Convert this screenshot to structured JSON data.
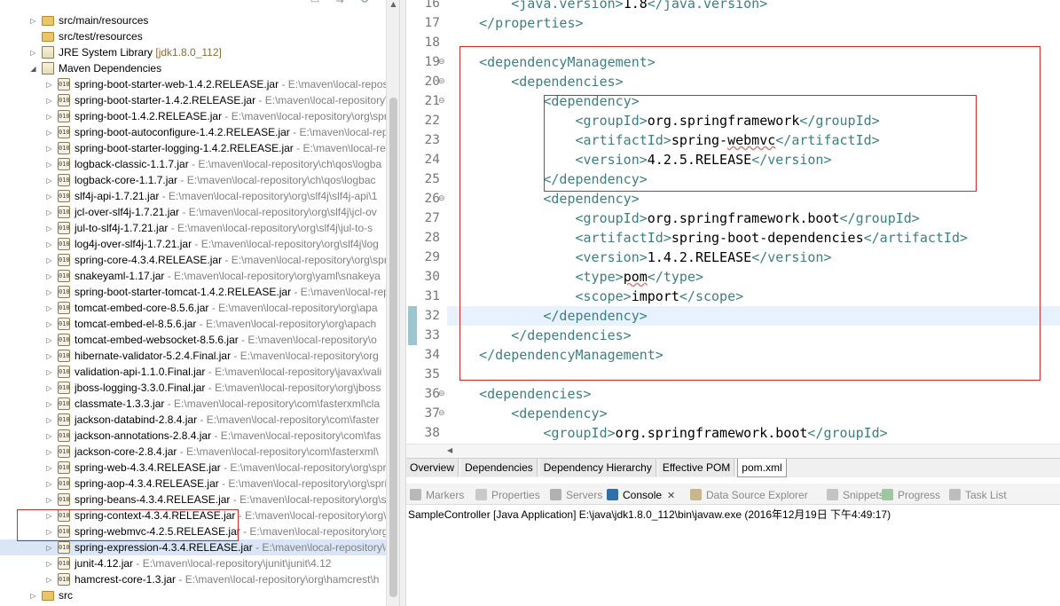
{
  "explorer": {
    "tree": [
      {
        "indent": 1,
        "twisty": "▷",
        "icon": "folder",
        "label": "src/main/resources",
        "path": ""
      },
      {
        "indent": 1,
        "twisty": "",
        "icon": "folder",
        "label": "src/test/resources",
        "path": ""
      },
      {
        "indent": 1,
        "twisty": "▷",
        "icon": "library",
        "label": "JRE System Library",
        "path": "",
        "jdk": "[jdk1.8.0_112]"
      },
      {
        "indent": 1,
        "twisty": "◢",
        "icon": "library",
        "label": "Maven Dependencies",
        "path": ""
      },
      {
        "indent": 2,
        "twisty": "▷",
        "icon": "jar",
        "label": "spring-boot-starter-web-1.4.2.RELEASE.jar",
        "path": " - E:\\maven\\local-reposi"
      },
      {
        "indent": 2,
        "twisty": "▷",
        "icon": "jar",
        "label": "spring-boot-starter-1.4.2.RELEASE.jar",
        "path": " - E:\\maven\\local-repository\\"
      },
      {
        "indent": 2,
        "twisty": "▷",
        "icon": "jar",
        "label": "spring-boot-1.4.2.RELEASE.jar",
        "path": " - E:\\maven\\local-repository\\org\\spr"
      },
      {
        "indent": 2,
        "twisty": "▷",
        "icon": "jar",
        "label": "spring-boot-autoconfigure-1.4.2.RELEASE.jar",
        "path": " - E:\\maven\\local-rep"
      },
      {
        "indent": 2,
        "twisty": "▷",
        "icon": "jar",
        "label": "spring-boot-starter-logging-1.4.2.RELEASE.jar",
        "path": " - E:\\maven\\local-rep"
      },
      {
        "indent": 2,
        "twisty": "▷",
        "icon": "jar",
        "label": "logback-classic-1.1.7.jar",
        "path": " - E:\\maven\\local-repository\\ch\\qos\\logba"
      },
      {
        "indent": 2,
        "twisty": "▷",
        "icon": "jar",
        "label": "logback-core-1.1.7.jar",
        "path": " - E:\\maven\\local-repository\\ch\\qos\\logbac"
      },
      {
        "indent": 2,
        "twisty": "▷",
        "icon": "jar",
        "label": "slf4j-api-1.7.21.jar",
        "path": " - E:\\maven\\local-repository\\org\\slf4j\\slf4j-api\\1"
      },
      {
        "indent": 2,
        "twisty": "▷",
        "icon": "jar",
        "label": "jcl-over-slf4j-1.7.21.jar",
        "path": " - E:\\maven\\local-repository\\org\\slf4j\\jcl-ov"
      },
      {
        "indent": 2,
        "twisty": "▷",
        "icon": "jar",
        "label": "jul-to-slf4j-1.7.21.jar",
        "path": " - E:\\maven\\local-repository\\org\\slf4j\\jul-to-s"
      },
      {
        "indent": 2,
        "twisty": "▷",
        "icon": "jar",
        "label": "log4j-over-slf4j-1.7.21.jar",
        "path": " - E:\\maven\\local-repository\\org\\slf4j\\log"
      },
      {
        "indent": 2,
        "twisty": "▷",
        "icon": "jar",
        "label": "spring-core-4.3.4.RELEASE.jar",
        "path": " - E:\\maven\\local-repository\\org\\spr"
      },
      {
        "indent": 2,
        "twisty": "▷",
        "icon": "jar",
        "label": "snakeyaml-1.17.jar",
        "path": " - E:\\maven\\local-repository\\org\\yaml\\snakeya"
      },
      {
        "indent": 2,
        "twisty": "▷",
        "icon": "jar",
        "label": "spring-boot-starter-tomcat-1.4.2.RELEASE.jar",
        "path": " - E:\\maven\\local-rep"
      },
      {
        "indent": 2,
        "twisty": "▷",
        "icon": "jar",
        "label": "tomcat-embed-core-8.5.6.jar",
        "path": " - E:\\maven\\local-repository\\org\\apa"
      },
      {
        "indent": 2,
        "twisty": "▷",
        "icon": "jar",
        "label": "tomcat-embed-el-8.5.6.jar",
        "path": " - E:\\maven\\local-repository\\org\\apach"
      },
      {
        "indent": 2,
        "twisty": "▷",
        "icon": "jar",
        "label": "tomcat-embed-websocket-8.5.6.jar",
        "path": " - E:\\maven\\local-repository\\o"
      },
      {
        "indent": 2,
        "twisty": "▷",
        "icon": "jar",
        "label": "hibernate-validator-5.2.4.Final.jar",
        "path": " - E:\\maven\\local-repository\\org"
      },
      {
        "indent": 2,
        "twisty": "▷",
        "icon": "jar",
        "label": "validation-api-1.1.0.Final.jar",
        "path": " - E:\\maven\\local-repository\\javax\\vali"
      },
      {
        "indent": 2,
        "twisty": "▷",
        "icon": "jar",
        "label": "jboss-logging-3.3.0.Final.jar",
        "path": " - E:\\maven\\local-repository\\org\\jboss"
      },
      {
        "indent": 2,
        "twisty": "▷",
        "icon": "jar",
        "label": "classmate-1.3.3.jar",
        "path": " - E:\\maven\\local-repository\\com\\fasterxml\\cla"
      },
      {
        "indent": 2,
        "twisty": "▷",
        "icon": "jar",
        "label": "jackson-databind-2.8.4.jar",
        "path": " - E:\\maven\\local-repository\\com\\faster"
      },
      {
        "indent": 2,
        "twisty": "▷",
        "icon": "jar",
        "label": "jackson-annotations-2.8.4.jar",
        "path": " - E:\\maven\\local-repository\\com\\fas"
      },
      {
        "indent": 2,
        "twisty": "▷",
        "icon": "jar",
        "label": "jackson-core-2.8.4.jar",
        "path": " - E:\\maven\\local-repository\\com\\fasterxml\\"
      },
      {
        "indent": 2,
        "twisty": "▷",
        "icon": "jar",
        "label": "spring-web-4.3.4.RELEASE.jar",
        "path": " - E:\\maven\\local-repository\\org\\spri"
      },
      {
        "indent": 2,
        "twisty": "▷",
        "icon": "jar",
        "label": "spring-aop-4.3.4.RELEASE.jar",
        "path": " - E:\\maven\\local-repository\\org\\spri"
      },
      {
        "indent": 2,
        "twisty": "▷",
        "icon": "jar",
        "label": "spring-beans-4.3.4.RELEASE.jar",
        "path": " - E:\\maven\\local-repository\\org\\spr"
      },
      {
        "indent": 2,
        "twisty": "▷",
        "icon": "jar",
        "label": "spring-context-4.3.4.RELEASE.jar",
        "path": " - E:\\maven\\local-repository\\org\\"
      },
      {
        "indent": 2,
        "twisty": "▷",
        "icon": "jar",
        "label": "spring-webmvc-4.2.5.RELEASE.jar",
        "path": " - E:\\maven\\local-repository\\org"
      },
      {
        "indent": 2,
        "twisty": "▷",
        "icon": "jar",
        "label": "spring-expression-4.3.4.RELEASE.jar",
        "path": " - E:\\maven\\local-repository\\o",
        "selected": true
      },
      {
        "indent": 2,
        "twisty": "▷",
        "icon": "jar",
        "label": "junit-4.12.jar",
        "path": " - E:\\maven\\local-repository\\junit\\junit\\4.12"
      },
      {
        "indent": 2,
        "twisty": "▷",
        "icon": "jar",
        "label": "hamcrest-core-1.3.jar",
        "path": " - E:\\maven\\local-repository\\org\\hamcrest\\h"
      },
      {
        "indent": 1,
        "twisty": "▷",
        "icon": "folder",
        "label": "src",
        "path": ""
      }
    ]
  },
  "editor": {
    "lines": [
      {
        "n": "16",
        "fold": "",
        "code": [
          [
            "t",
            "        <"
          ],
          [
            "t",
            "java.version"
          ],
          [
            "t",
            ">"
          ],
          [
            "x",
            "1.8"
          ],
          [
            "t",
            "</"
          ],
          [
            "t",
            "java.version"
          ],
          [
            "t",
            ">"
          ]
        ]
      },
      {
        "n": "17",
        "fold": "",
        "code": [
          [
            "t",
            "    </properties>"
          ]
        ]
      },
      {
        "n": "18",
        "fold": "",
        "code": []
      },
      {
        "n": "19",
        "fold": "⊖",
        "code": [
          [
            "t",
            "    <dependencyManagement>"
          ]
        ]
      },
      {
        "n": "20",
        "fold": "⊖",
        "code": [
          [
            "t",
            "        <dependencies>"
          ]
        ]
      },
      {
        "n": "21",
        "fold": "⊖",
        "code": [
          [
            "t",
            "            <dependency>"
          ]
        ]
      },
      {
        "n": "22",
        "fold": "",
        "code": [
          [
            "t",
            "                <groupId>"
          ],
          [
            "x",
            "org.springframework"
          ],
          [
            "t",
            "</groupId>"
          ]
        ]
      },
      {
        "n": "23",
        "fold": "",
        "code": [
          [
            "t",
            "                <artifactId>"
          ],
          [
            "x",
            "spring-"
          ],
          [
            "s",
            "webmvc"
          ],
          [
            "t",
            "</artifactId>"
          ]
        ]
      },
      {
        "n": "24",
        "fold": "",
        "code": [
          [
            "t",
            "                <version>"
          ],
          [
            "x",
            "4.2.5.RELEASE"
          ],
          [
            "t",
            "</version>"
          ]
        ]
      },
      {
        "n": "25",
        "fold": "",
        "code": [
          [
            "t",
            "            </dependency>"
          ]
        ]
      },
      {
        "n": "26",
        "fold": "⊖",
        "code": [
          [
            "t",
            "            <dependency>"
          ]
        ]
      },
      {
        "n": "27",
        "fold": "",
        "code": [
          [
            "t",
            "                <groupId>"
          ],
          [
            "x",
            "org.springframework.boot"
          ],
          [
            "t",
            "</groupId>"
          ]
        ]
      },
      {
        "n": "28",
        "fold": "",
        "code": [
          [
            "t",
            "                <artifactId>"
          ],
          [
            "x",
            "spring-boot-dependencies"
          ],
          [
            "t",
            "</artifactId>"
          ]
        ]
      },
      {
        "n": "29",
        "fold": "",
        "code": [
          [
            "t",
            "                <version>"
          ],
          [
            "x",
            "1.4.2.RELEASE"
          ],
          [
            "t",
            "</version>"
          ]
        ]
      },
      {
        "n": "30",
        "fold": "",
        "code": [
          [
            "t",
            "                <type>"
          ],
          [
            "s",
            "pom"
          ],
          [
            "t",
            "</type>"
          ]
        ]
      },
      {
        "n": "31",
        "fold": "",
        "code": [
          [
            "t",
            "                <scope>"
          ],
          [
            "x",
            "import"
          ],
          [
            "t",
            "</scope>"
          ]
        ]
      },
      {
        "n": "32",
        "fold": "",
        "code": [
          [
            "t",
            "            </dependency>"
          ]
        ]
      },
      {
        "n": "33",
        "fold": "",
        "code": [
          [
            "t",
            "        </dependencies>"
          ]
        ]
      },
      {
        "n": "34",
        "fold": "",
        "code": [
          [
            "t",
            "    </dependencyManagement>"
          ]
        ]
      },
      {
        "n": "35",
        "fold": "",
        "code": []
      },
      {
        "n": "36",
        "fold": "⊖",
        "code": [
          [
            "t",
            "    <dependencies>"
          ]
        ]
      },
      {
        "n": "37",
        "fold": "⊖",
        "code": [
          [
            "t",
            "        <dependency>"
          ]
        ]
      },
      {
        "n": "38",
        "fold": "",
        "code": [
          [
            "t",
            "            <groupId>"
          ],
          [
            "x",
            "org.springframework.boot"
          ],
          [
            "t",
            "</groupId>"
          ]
        ]
      }
    ]
  },
  "pom_tabs": [
    "Overview",
    "Dependencies",
    "Dependency Hierarchy",
    "Effective POM",
    "pom.xml"
  ],
  "view_tabs": [
    {
      "label": "Markers",
      "icon": "markers-icon",
      "color": "#b8b8b8",
      "active": false
    },
    {
      "label": "Properties",
      "icon": "properties-icon",
      "color": "#c9c9c9",
      "active": false
    },
    {
      "label": "Servers",
      "icon": "servers-icon",
      "color": "#b0b0b0",
      "active": false
    },
    {
      "label": "Console",
      "icon": "console-icon",
      "color": "#2f6fa8",
      "active": true
    },
    {
      "label": "Data Source Explorer",
      "icon": "data-source-icon",
      "color": "#c8b78c",
      "active": false
    },
    {
      "label": "Snippets",
      "icon": "snippets-icon",
      "color": "#c4c4c4",
      "active": false
    },
    {
      "label": "Progress",
      "icon": "progress-icon",
      "color": "#9fc79f",
      "active": false
    },
    {
      "label": "Task List",
      "icon": "task-list-icon",
      "color": "#bdbdbd",
      "active": false
    }
  ],
  "console": {
    "text": "SampleController [Java Application] E:\\java\\jdk1.8.0_112\\bin\\javaw.exe (2016年12月19日 下午4:49:17)"
  },
  "colors": {
    "tag": "#3f7f7f",
    "highlight_box": "#d02a2a",
    "current_line": "#e8f2fe"
  }
}
